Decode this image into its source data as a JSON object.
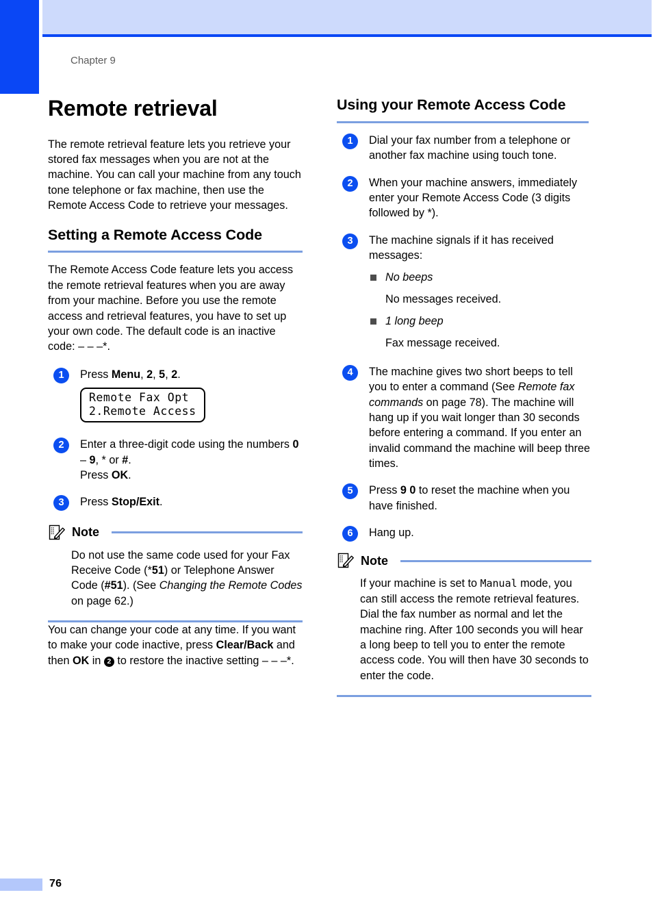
{
  "page": {
    "chapter_label": "Chapter 9",
    "page_number": "76",
    "accent_blue": "#0a47f5",
    "band_blue": "#cddafc",
    "rule_blue": "#7b9fe0"
  },
  "left_column": {
    "title": "Remote retrieval",
    "intro": "The remote retrieval feature lets you retrieve your stored fax messages when you are not at the machine. You can call your machine from any touch tone telephone or fax machine, then use the Remote Access Code to retrieve your messages.",
    "section_title": "Setting a Remote Access Code",
    "section_intro_a": "The Remote Access Code feature lets you access the remote retrieval features when you are away from your machine. Before you use the remote access and retrieval features, you have to set up your own code. The default code is an inactive code: ",
    "section_intro_code": "– – –",
    "section_intro_star": "*",
    "section_intro_end": ".",
    "steps": [
      {
        "number": "1",
        "prefix": "Press ",
        "bold1": "Menu",
        "sep1": ", ",
        "bold2": "2",
        "sep2": ", ",
        "bold3": "5",
        "sep3": ", ",
        "bold4": "2",
        "suffix": ".",
        "lcd": {
          "line1": "Remote Fax Opt",
          "line2": "2.Remote Access"
        }
      },
      {
        "number": "2",
        "text_a": "Enter a three-digit code using the numbers ",
        "bold_a": "0",
        "text_b": " – ",
        "bold_b": "9",
        "text_c": ", ",
        "star": "*",
        "text_d": " or ",
        "bold_c": "#",
        "text_e": ".",
        "line2_a": "Press ",
        "line2_bold": "OK",
        "line2_b": "."
      },
      {
        "number": "3",
        "prefix": "Press ",
        "bold1": "Stop/Exit",
        "suffix": "."
      }
    ],
    "note": {
      "title": "Note",
      "icon": "note-pencil-icon",
      "text_a": "Do not use the same code used for your Fax Receive Code (",
      "star_a": "*",
      "bold_a": "51",
      "text_b": ") or Telephone Answer Code (",
      "bold_b": "#51",
      "text_c": "). (See ",
      "italic_a": "Changing the Remote Codes",
      "text_d": " on page 62.)"
    },
    "closing_a": "You can change your code at any time. If you want to make your code inactive, press ",
    "closing_bold_a": "Clear/Back",
    "closing_b": " and then ",
    "closing_bold_b": "OK",
    "closing_c": " in ",
    "closing_badge": "2",
    "closing_d": " to restore the inactive setting ",
    "closing_code": "– – –",
    "closing_star": "*",
    "closing_end": "."
  },
  "right_column": {
    "section_title": "Using your Remote Access Code",
    "steps": [
      {
        "number": "1",
        "text": "Dial your fax number from a telephone or another fax machine using touch tone."
      },
      {
        "number": "2",
        "text_a": "When your machine answers, immediately enter your Remote Access Code (3 digits followed by ",
        "star": "*",
        "text_b": ")."
      },
      {
        "number": "3",
        "text": "The machine signals if it has received messages:",
        "bullets": [
          {
            "label": "No beeps",
            "detail": "No messages received."
          },
          {
            "label": "1 long beep",
            "detail": "Fax message received."
          }
        ]
      },
      {
        "number": "4",
        "text_a": "The machine gives two short beeps to tell you to enter a command (See ",
        "italic_a": "Remote fax commands",
        "text_b": " on page 78). The machine will hang up if you wait longer than 30 seconds before entering a command. If you enter an invalid command the machine will beep three times."
      },
      {
        "number": "5",
        "text_a": "Press ",
        "bold_a": "9 0",
        "text_b": " to reset the machine when you have finished."
      },
      {
        "number": "6",
        "text": "Hang up."
      }
    ],
    "note": {
      "title": "Note",
      "icon": "note-pencil-icon",
      "text_a": "If your machine is set to ",
      "mono_a": "Manual",
      "text_b": " mode, you can still access the remote retrieval features. Dial the fax number as normal and let the machine ring. After 100 seconds you will hear a long beep to tell you to enter the remote access code. You will then have 30 seconds to enter the code."
    }
  }
}
